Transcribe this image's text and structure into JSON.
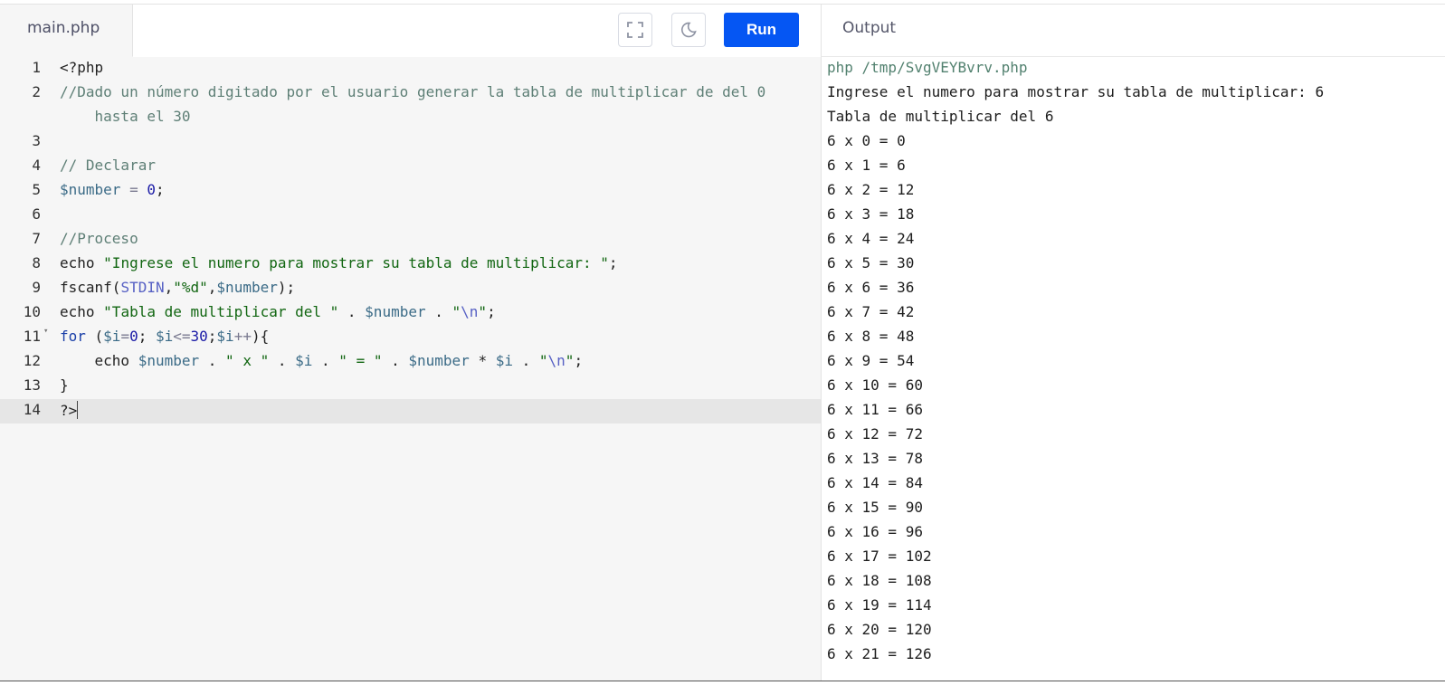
{
  "editor": {
    "file_tab": "main.php",
    "lines": [
      {
        "n": "1",
        "tokens": [
          {
            "t": "<?php",
            "c": "plain"
          }
        ]
      },
      {
        "n": "2",
        "tokens": [
          {
            "t": "//Dado un número digitado por el usuario generar la tabla de multiplicar de del 0",
            "c": "cmt"
          }
        ]
      },
      {
        "n": "",
        "tokens": [
          {
            "t": "    hasta el 30",
            "c": "cmt"
          }
        ]
      },
      {
        "n": "3",
        "tokens": []
      },
      {
        "n": "4",
        "tokens": [
          {
            "t": "// Declarar",
            "c": "cmt"
          }
        ]
      },
      {
        "n": "5",
        "tokens": [
          {
            "t": "$number",
            "c": "var"
          },
          {
            "t": " = ",
            "c": "op"
          },
          {
            "t": "0",
            "c": "num"
          },
          {
            "t": ";",
            "c": "plain"
          }
        ]
      },
      {
        "n": "6",
        "tokens": []
      },
      {
        "n": "7",
        "tokens": [
          {
            "t": "//Proceso",
            "c": "cmt"
          }
        ]
      },
      {
        "n": "8",
        "tokens": [
          {
            "t": "echo ",
            "c": "plain"
          },
          {
            "t": "\"Ingrese el numero para mostrar su tabla de multiplicar: \"",
            "c": "str"
          },
          {
            "t": ";",
            "c": "plain"
          }
        ]
      },
      {
        "n": "9",
        "tokens": [
          {
            "t": "fscanf(",
            "c": "plain"
          },
          {
            "t": "STDIN",
            "c": "const"
          },
          {
            "t": ",",
            "c": "plain"
          },
          {
            "t": "\"%d\"",
            "c": "str"
          },
          {
            "t": ",",
            "c": "plain"
          },
          {
            "t": "$number",
            "c": "var"
          },
          {
            "t": ");",
            "c": "plain"
          }
        ]
      },
      {
        "n": "10",
        "tokens": [
          {
            "t": "echo ",
            "c": "plain"
          },
          {
            "t": "\"Tabla de multiplicar del \"",
            "c": "str"
          },
          {
            "t": " . ",
            "c": "plain"
          },
          {
            "t": "$number",
            "c": "var"
          },
          {
            "t": " . ",
            "c": "plain"
          },
          {
            "t": "\"",
            "c": "str"
          },
          {
            "t": "\\n",
            "c": "esc"
          },
          {
            "t": "\"",
            "c": "str"
          },
          {
            "t": ";",
            "c": "plain"
          }
        ]
      },
      {
        "n": "11",
        "fold": "true",
        "tokens": [
          {
            "t": "for",
            "c": "kw"
          },
          {
            "t": " (",
            "c": "plain"
          },
          {
            "t": "$i",
            "c": "var"
          },
          {
            "t": "=",
            "c": "op"
          },
          {
            "t": "0",
            "c": "num"
          },
          {
            "t": "; ",
            "c": "plain"
          },
          {
            "t": "$i",
            "c": "var"
          },
          {
            "t": "<=",
            "c": "op"
          },
          {
            "t": "30",
            "c": "num"
          },
          {
            "t": ";",
            "c": "plain"
          },
          {
            "t": "$i",
            "c": "var"
          },
          {
            "t": "++",
            "c": "op"
          },
          {
            "t": "){",
            "c": "plain"
          }
        ]
      },
      {
        "n": "12",
        "tokens": [
          {
            "t": "    echo ",
            "c": "plain"
          },
          {
            "t": "$number",
            "c": "var"
          },
          {
            "t": " . ",
            "c": "plain"
          },
          {
            "t": "\" x \"",
            "c": "str"
          },
          {
            "t": " . ",
            "c": "plain"
          },
          {
            "t": "$i",
            "c": "var"
          },
          {
            "t": " . ",
            "c": "plain"
          },
          {
            "t": "\" = \"",
            "c": "str"
          },
          {
            "t": " . ",
            "c": "plain"
          },
          {
            "t": "$number",
            "c": "var"
          },
          {
            "t": " * ",
            "c": "plain"
          },
          {
            "t": "$i",
            "c": "var"
          },
          {
            "t": " . ",
            "c": "plain"
          },
          {
            "t": "\"",
            "c": "str"
          },
          {
            "t": "\\n",
            "c": "esc"
          },
          {
            "t": "\"",
            "c": "str"
          },
          {
            "t": ";",
            "c": "plain"
          }
        ]
      },
      {
        "n": "13",
        "tokens": [
          {
            "t": "}",
            "c": "plain"
          }
        ]
      },
      {
        "n": "14",
        "active": "true",
        "tokens": [
          {
            "t": "?>",
            "c": "plain"
          }
        ]
      }
    ]
  },
  "toolbar": {
    "fullscreen_icon": "fullscreen-icon",
    "theme_icon": "moon-icon",
    "run_label": "Run"
  },
  "output": {
    "title": "Output",
    "command": "php /tmp/SvgVEYBvrv.php",
    "lines": [
      "Ingrese el numero para mostrar su tabla de multiplicar: 6",
      "Tabla de multiplicar del 6",
      "6 x 0 = 0",
      "6 x 1 = 6",
      "6 x 2 = 12",
      "6 x 3 = 18",
      "6 x 4 = 24",
      "6 x 5 = 30",
      "6 x 6 = 36",
      "6 x 7 = 42",
      "6 x 8 = 48",
      "6 x 9 = 54",
      "6 x 10 = 60",
      "6 x 11 = 66",
      "6 x 12 = 72",
      "6 x 13 = 78",
      "6 x 14 = 84",
      "6 x 15 = 90",
      "6 x 16 = 96",
      "6 x 17 = 102",
      "6 x 18 = 108",
      "6 x 19 = 114",
      "6 x 20 = 120",
      "6 x 21 = 126"
    ]
  },
  "colors": {
    "run_button": "#0556f3",
    "comment": "#5e7f76",
    "string": "#116611",
    "variable": "#3b6b87"
  }
}
